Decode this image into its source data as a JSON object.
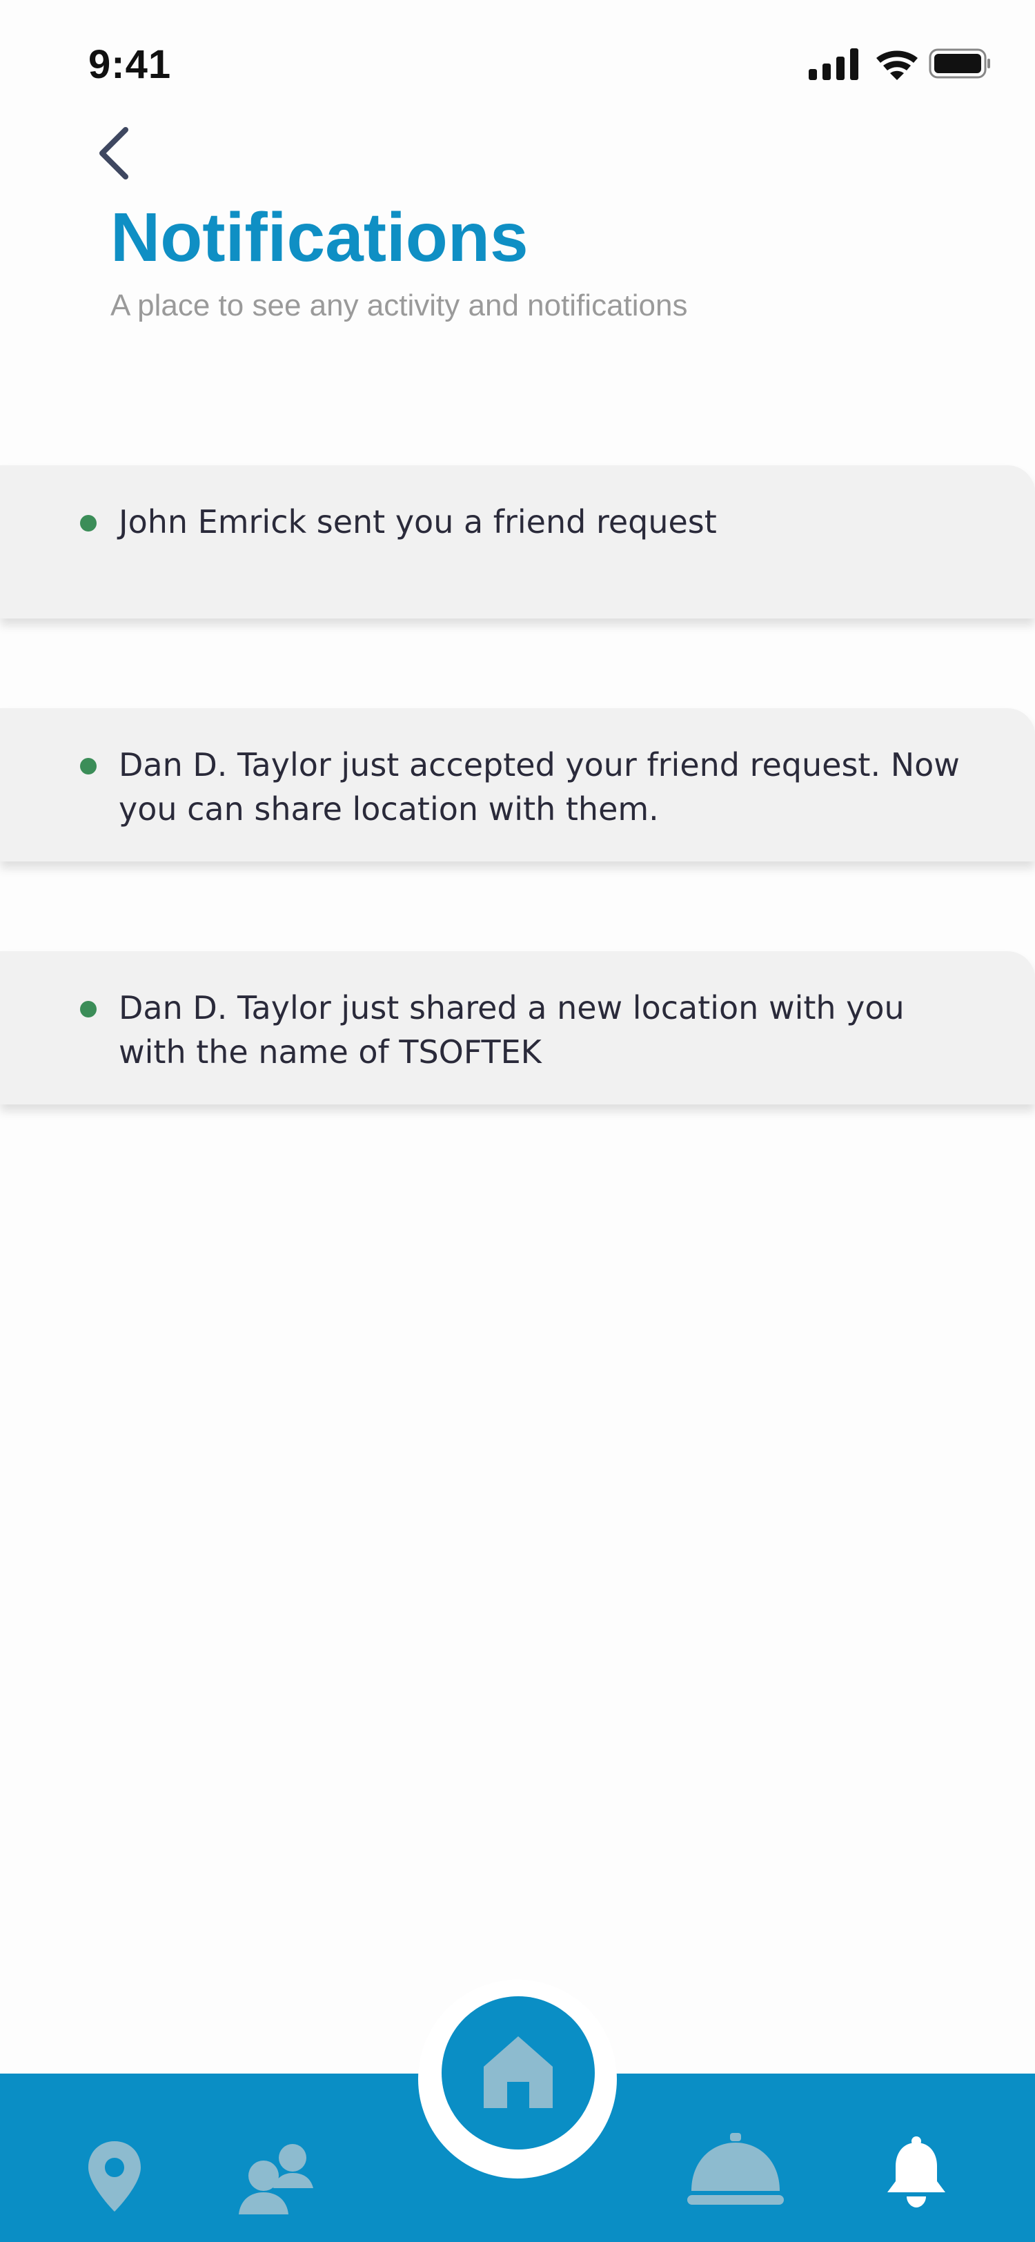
{
  "status_bar": {
    "time": "9:41"
  },
  "header": {
    "title": "Notifications",
    "subtitle": "A place to see any activity and notifications"
  },
  "notifications": [
    {
      "text": "John Emrick sent you a friend request",
      "unread": true
    },
    {
      "text": "Dan D. Taylor just accepted your friend request. Now you can share location with them.",
      "unread": true
    },
    {
      "text": "Dan D. Taylor just shared a new location with you with the name of TSOFTEK",
      "unread": true
    }
  ],
  "tab_bar": {
    "items": [
      {
        "icon": "location-pin-icon",
        "active": false
      },
      {
        "icon": "friends-icon",
        "active": false
      },
      {
        "icon": "home-icon",
        "active": false
      },
      {
        "icon": "service-bell-icon",
        "active": false
      },
      {
        "icon": "bell-icon",
        "active": true
      }
    ]
  },
  "colors": {
    "accent": "#0f8fc4",
    "tab_bar": "#0a8ec5",
    "inactive_icon": "#8dbbcf",
    "active_icon": "#ffffff",
    "unread_dot": "#3b8d58",
    "card_background": "#f1f1f1"
  }
}
